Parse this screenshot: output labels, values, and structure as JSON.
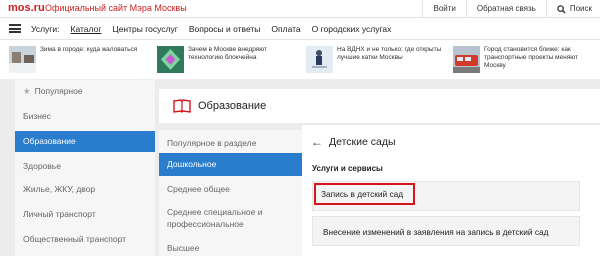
{
  "topbar": {
    "logo": "mos.ru",
    "site_title": "Официальный сайт Мэра Москвы",
    "links": [
      "Войти",
      "Обратная связь"
    ],
    "search_label": "Поиск"
  },
  "navbar": {
    "label": "Услуги:",
    "items": [
      "Каталог",
      "Центры госуслуг",
      "Вопросы и ответы",
      "Оплата",
      "О городских услугах"
    ],
    "active_item": "Каталог"
  },
  "news": [
    {
      "text": "Зима в городе: куда жаловаться",
      "icon": "snow-thumbnail"
    },
    {
      "text": "Зачем в Москве внедряют технологию блокчейна",
      "icon": "blockchain-thumbnail"
    },
    {
      "text": "На ВДНХ и не только: где открыты лучшие катки Москвы",
      "icon": "skating-thumbnail"
    },
    {
      "text": "Город становится ближе: как транспортные проекты меняют Москву",
      "icon": "train-thumbnail"
    }
  ],
  "sidebar": {
    "items": [
      {
        "label": "Популярное",
        "icon": "star-icon"
      },
      {
        "label": "Бизнес"
      },
      {
        "label": "Образование"
      },
      {
        "label": "Здоровье"
      },
      {
        "label": "Жилье, ЖКУ, двор"
      },
      {
        "label": "Личный транспорт"
      },
      {
        "label": "Общественный транспорт"
      }
    ],
    "active_index": 2
  },
  "category": {
    "title": "Образование",
    "icon": "book-icon",
    "items": [
      "Популярное в разделе",
      "Дошкольное",
      "Среднее общее",
      "Среднее специальное и профессиональное",
      "Высшее"
    ],
    "active_index": 1
  },
  "subcategory": {
    "back_icon": "arrow-left-icon",
    "title": "Детские сады",
    "section_label": "Услуги и сервисы",
    "services": [
      "Запись в детский сад",
      "Внесение изменений в заявления на запись в детский сад"
    ],
    "highlighted_index": 0,
    "highlight_color": "#d6141c"
  },
  "colors": {
    "brand": "#cc1f1f",
    "active": "#2a7ccc"
  }
}
